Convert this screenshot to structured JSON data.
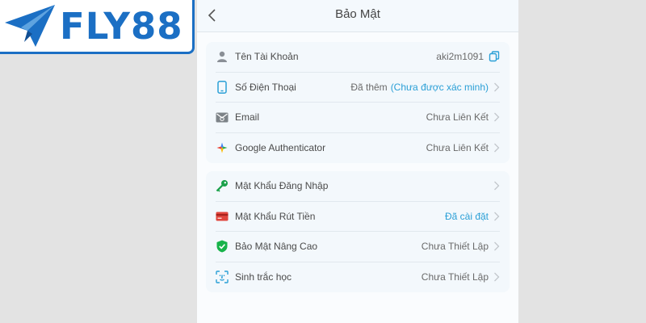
{
  "brand": {
    "name": "FLY88",
    "color": "#1b6fc4"
  },
  "header": {
    "title": "Bảo Mật"
  },
  "account_section": [
    {
      "label": "Tên Tài Khoản",
      "value": "aki2m1091",
      "icon": "user-icon"
    },
    {
      "label": "Số Điện Thoại",
      "value": "Đã thêm",
      "status": "(Chưa được xác minh)",
      "icon": "phone-icon"
    },
    {
      "label": "Email",
      "value": "Chưa Liên Kết",
      "icon": "email-icon"
    },
    {
      "label": "Google Authenticator",
      "value": "Chưa Liên Kết",
      "icon": "google-authenticator-icon"
    }
  ],
  "password_section": [
    {
      "label": "Mật Khẩu Đăng Nhập",
      "value": "",
      "icon": "key-icon"
    },
    {
      "label": "Mật Khẩu Rút Tiền",
      "value": "Đã cài đặt",
      "icon": "card-icon"
    },
    {
      "label": "Bảo Mật Nâng Cao",
      "value": "Chưa Thiết Lập",
      "icon": "shield-icon"
    },
    {
      "label": "Sinh trắc học",
      "value": "Chưa Thiết Lập",
      "icon": "face-id-icon"
    }
  ],
  "colors": {
    "accent": "#2a9fd6",
    "key_green": "#1aa14a",
    "card_red": "#e0453c",
    "shield_green": "#17b34a"
  }
}
